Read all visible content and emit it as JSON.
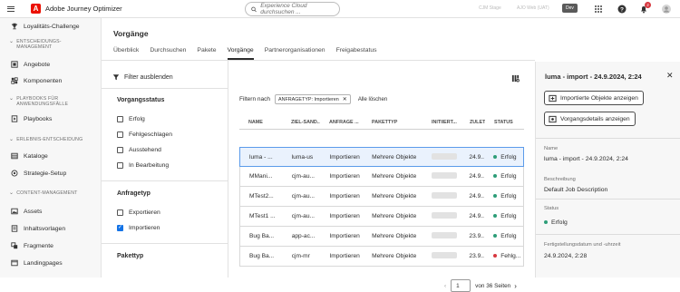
{
  "topbar": {
    "app_title": "Adobe Journey Optimizer",
    "search_placeholder": "Experience Cloud durchsuchen ...",
    "sandbox_label": "CJM Stage",
    "user_label": "AJO Web (UAT)",
    "env_badge": "Dev",
    "notification_count": "2"
  },
  "sidebar": {
    "items": [
      {
        "label": "Loyalitäts-Challenge",
        "icon": "trophy-icon"
      },
      {
        "section": "ENTSCHEIDUNGS-MANAGEMENT"
      },
      {
        "label": "Angebote",
        "icon": "offer-icon"
      },
      {
        "label": "Komponenten",
        "icon": "components-icon"
      },
      {
        "section": "PLAYBOOKS FÜR ANWENDUNGSFÄLLE"
      },
      {
        "label": "Playbooks",
        "icon": "playbook-icon"
      },
      {
        "section": "ERLEBNIS-ENTSCHEIDUNG"
      },
      {
        "label": "Kataloge",
        "icon": "catalog-icon"
      },
      {
        "label": "Strategie-Setup",
        "icon": "strategy-icon"
      },
      {
        "section": "CONTENT-MANAGEMENT"
      },
      {
        "label": "Assets",
        "icon": "assets-icon"
      },
      {
        "label": "Inhaltsvorlagen",
        "icon": "template-icon"
      },
      {
        "label": "Fragmente",
        "icon": "fragment-icon"
      },
      {
        "label": "Landingpages",
        "icon": "landing-page-icon"
      }
    ]
  },
  "main": {
    "title": "Vorgänge",
    "tabs": [
      "Überblick",
      "Durchsuchen",
      "Pakete",
      "Vorgänge",
      "Partnerorganisationen",
      "Freigabestatus"
    ],
    "active_tab": "Vorgänge"
  },
  "filters": {
    "hide_label": "Filter ausblenden",
    "status_heading": "Vorgangsstatus",
    "status_options": [
      {
        "label": "Erfolg",
        "checked": false
      },
      {
        "label": "Fehlgeschlagen",
        "checked": false
      },
      {
        "label": "Ausstehend",
        "checked": false
      },
      {
        "label": "In Bearbeitung",
        "checked": false
      }
    ],
    "request_heading": "Anfragetyp",
    "request_options": [
      {
        "label": "Exportieren",
        "checked": false
      },
      {
        "label": "Importieren",
        "checked": true
      }
    ],
    "package_heading": "Pakettyp"
  },
  "table": {
    "filter_by_label": "Filtern nach",
    "active_filter_tag": "ANFRAGETYP: Importieren",
    "clear_all": "Alle löschen",
    "columns": [
      "NAME",
      "ZIEL-SAND...",
      "ANFRAGE ...",
      "PAKETTYP",
      "INITIIERT...",
      "ZULETZT...",
      "STATUS"
    ],
    "rows": [
      {
        "name": "luma - ...",
        "sandbox": "luma-us",
        "request": "Importieren",
        "package": "Mehrere Objekte",
        "date": "24.9....",
        "status": "Erfolg",
        "status_color": "#2d9d78",
        "selected": true
      },
      {
        "name": "MMani...",
        "sandbox": "cjm-au...",
        "request": "Importieren",
        "package": "Mehrere Objekte",
        "date": "24.9....",
        "status": "Erfolg",
        "status_color": "#2d9d78",
        "selected": false
      },
      {
        "name": "MTest2...",
        "sandbox": "cjm-au...",
        "request": "Importieren",
        "package": "Mehrere Objekte",
        "date": "24.9....",
        "status": "Erfolg",
        "status_color": "#2d9d78",
        "selected": false
      },
      {
        "name": "MTest1 ...",
        "sandbox": "cjm-au...",
        "request": "Importieren",
        "package": "Mehrere Objekte",
        "date": "24.9....",
        "status": "Erfolg",
        "status_color": "#2d9d78",
        "selected": false
      },
      {
        "name": "Bug Ba...",
        "sandbox": "app-ac...",
        "request": "Importieren",
        "package": "Mehrere Objekte",
        "date": "23.9....",
        "status": "Erfolg",
        "status_color": "#2d9d78",
        "selected": false
      },
      {
        "name": "Bug Ba...",
        "sandbox": "cjm-mr",
        "request": "Importieren",
        "package": "Mehrere Objekte",
        "date": "23.9....",
        "status": "Fehlg...",
        "status_color": "#d7373f",
        "selected": false
      }
    ],
    "pager_value": "1",
    "pager_total": "von 36 Seiten"
  },
  "detail": {
    "title": "luma - import - 24.9.2024, 2:24",
    "btn_imported": "Importierte Objekte anzeigen",
    "btn_details": "Vorgangsdetails anzeigen",
    "name_label": "Name",
    "name_value": "luma - import - 24.9.2024, 2:24",
    "desc_label": "Beschreibung",
    "desc_value": "Default Job Description",
    "status_label": "Status",
    "status_value": "Erfolg",
    "status_color": "#2d9d78",
    "completed_label": "Fertigstellungsdatum und -uhrzeit",
    "completed_value": "24.9.2024, 2:28"
  }
}
